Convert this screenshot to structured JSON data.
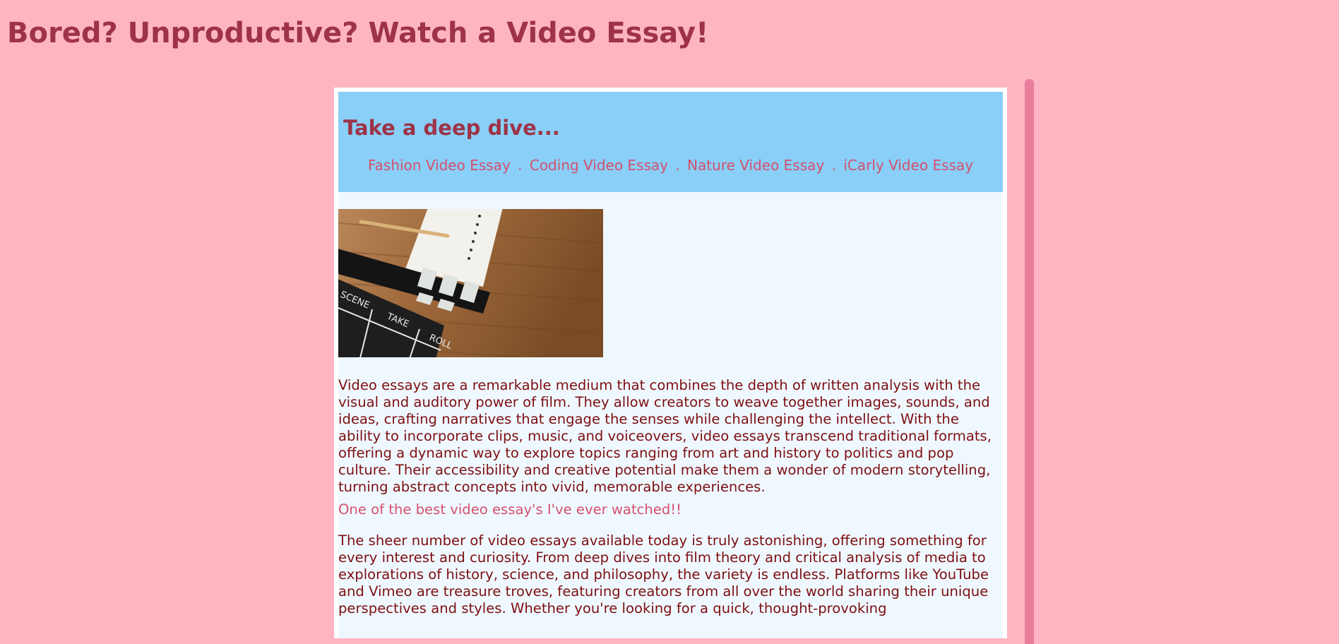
{
  "page": {
    "title": "Bored? Unproductive? Watch a Video Essay!"
  },
  "banner": {
    "title": "Take a deep dive...",
    "links": [
      {
        "label": "Fashion Video Essay"
      },
      {
        "label": "Coding Video Essay"
      },
      {
        "label": "Nature Video Essay"
      },
      {
        "label": "iCarly Video Essay"
      }
    ],
    "separator": "."
  },
  "image": {
    "clapperboard_labels": {
      "scene": "SCENE",
      "take": "TAKE",
      "roll": "ROLL"
    }
  },
  "content": {
    "paragraph_1": "Video essays are a remarkable medium that combines the depth of written analysis with the visual and auditory power of film. They allow creators to weave together images, sounds, and ideas, crafting narratives that engage the senses while challenging the intellect. With the ability to incorporate clips, music, and voiceovers, video essays transcend traditional formats, offering a dynamic way to explore topics ranging from art and history to politics and pop culture. Their accessibility and creative potential make them a wonder of modern storytelling, turning abstract concepts into vivid, memorable experiences.",
    "quote_link": "One of the best video essay's I've ever watched!!",
    "paragraph_2": "The sheer number of video essays available today is truly astonishing, offering something for every interest and curiosity. From deep dives into film theory and critical analysis of media to explorations of history, science, and philosophy, the variety is endless. Platforms like YouTube and Vimeo are treasure troves, featuring creators from all over the world sharing their unique perspectives and styles. Whether you're looking for a quick, thought-provoking"
  },
  "colors": {
    "background": "#ffb5c1",
    "title": "#9e3347",
    "banner": "#89cff7",
    "link": "#d4506d",
    "body_text": "#7d0f12",
    "card": "#eff8ff",
    "scrollbar": "#e87d9c"
  }
}
